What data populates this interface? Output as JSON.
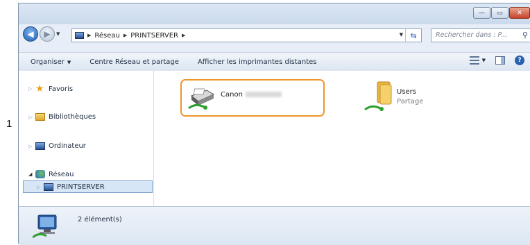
{
  "callout": "1",
  "window": {
    "title_buttons": [
      "—",
      "▭",
      "✕"
    ]
  },
  "address": {
    "crumbs": [
      "Réseau",
      "PRINTSERVER"
    ],
    "search_placeholder": "Rechercher dans : P..."
  },
  "commandbar": {
    "items": [
      "Organiser",
      "Centre Réseau et partage",
      "Afficher les imprimantes distantes"
    ]
  },
  "navpane": {
    "items": [
      {
        "label": "Favoris",
        "icon": "star-icon"
      },
      {
        "label": "Bibliothèques",
        "icon": "library-icon"
      },
      {
        "label": "Ordinateur",
        "icon": "computer-icon"
      },
      {
        "label": "Réseau",
        "icon": "network-icon"
      },
      {
        "label": "PRINTSERVER",
        "icon": "server-icon"
      }
    ]
  },
  "content": {
    "items": [
      {
        "label": "Canon",
        "icon": "shared-printer-icon"
      },
      {
        "label": "Users",
        "sublabel": "Partage",
        "icon": "shared-folder-icon"
      }
    ]
  },
  "status": {
    "count_text": "2 élément(s)"
  },
  "colors": {
    "highlight": "#f0962a",
    "selection": "#d6e6f7",
    "accent": "#2a62b0"
  }
}
